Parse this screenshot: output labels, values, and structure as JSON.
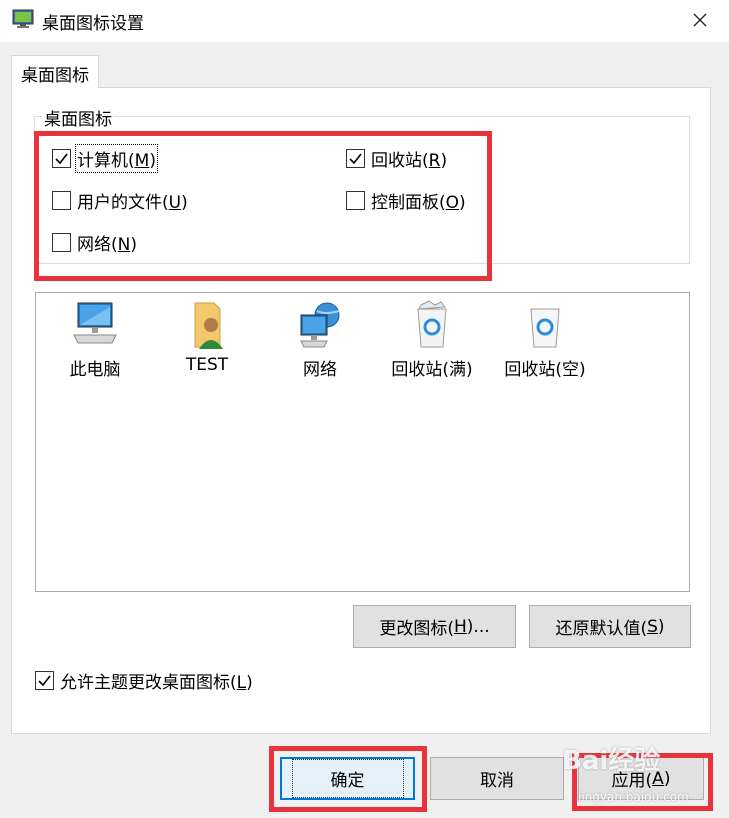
{
  "window": {
    "title": "桌面图标设置",
    "icon": "desktop-settings-icon",
    "close_icon": "close-icon"
  },
  "tab": {
    "label": "桌面图标"
  },
  "group": {
    "label": "桌面图标",
    "checkboxes": [
      {
        "prefix": "计算机(",
        "key": "M",
        "suffix": ")",
        "checked": true
      },
      {
        "prefix": "回收站(",
        "key": "R",
        "suffix": ")",
        "checked": true
      },
      {
        "prefix": "用户的文件(",
        "key": "U",
        "suffix": ")",
        "checked": false
      },
      {
        "prefix": "控制面板(",
        "key": "O",
        "suffix": ")",
        "checked": false
      },
      {
        "prefix": "网络(",
        "key": "N",
        "suffix": ")",
        "checked": false
      }
    ]
  },
  "icons": [
    {
      "label": "此电脑",
      "icon": "computer-icon"
    },
    {
      "label": "TEST",
      "icon": "user-folder-icon"
    },
    {
      "label": "网络",
      "icon": "network-icon"
    },
    {
      "label": "回收站(满)",
      "icon": "recycle-bin-full-icon"
    },
    {
      "label": "回收站(空)",
      "icon": "recycle-bin-empty-icon"
    }
  ],
  "buttons": {
    "change_icon": {
      "prefix": "更改图标(",
      "key": "H",
      "suffix": ")..."
    },
    "restore_default": {
      "prefix": "还原默认值(",
      "key": "S",
      "suffix": ")"
    },
    "ok": "确定",
    "cancel": "取消",
    "apply": {
      "prefix": "应用(",
      "key": "A",
      "suffix": ")"
    }
  },
  "allow_themes": {
    "prefix": "允许主题更改桌面图标(",
    "key": "L",
    "suffix": ")",
    "checked": true
  },
  "watermark": {
    "text": "Bai经验",
    "sub": "jingyan.baidu.com"
  },
  "colors": {
    "highlight": "#e8333c",
    "accent": "#0078d7"
  }
}
